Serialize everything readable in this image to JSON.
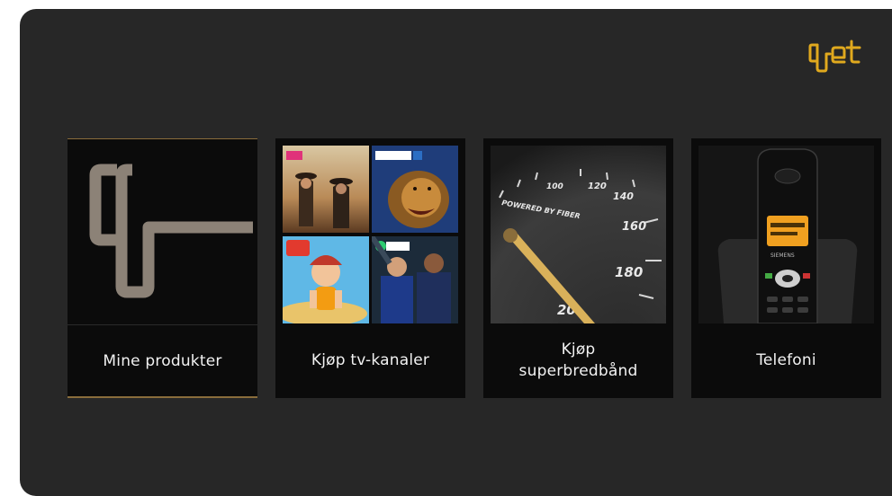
{
  "brand": {
    "logo_text": "get",
    "accent": "#e0a91e"
  },
  "tiles": [
    {
      "label": "Mine produkter",
      "icon": "get-logo-icon",
      "selected": true
    },
    {
      "label": "Kjøp tv-kanaler",
      "icon": "tv-channels-collage"
    },
    {
      "label": "Kjøp superbredbånd",
      "icon": "speedometer-image",
      "gauge_text": "POWERED BY FIBER",
      "gauge_ticks": [
        "100",
        "120",
        "140",
        "160",
        "180",
        "20"
      ]
    },
    {
      "label": "Telefoni",
      "icon": "cordless-phone-image",
      "phone_screen": "SIEMENS"
    }
  ]
}
